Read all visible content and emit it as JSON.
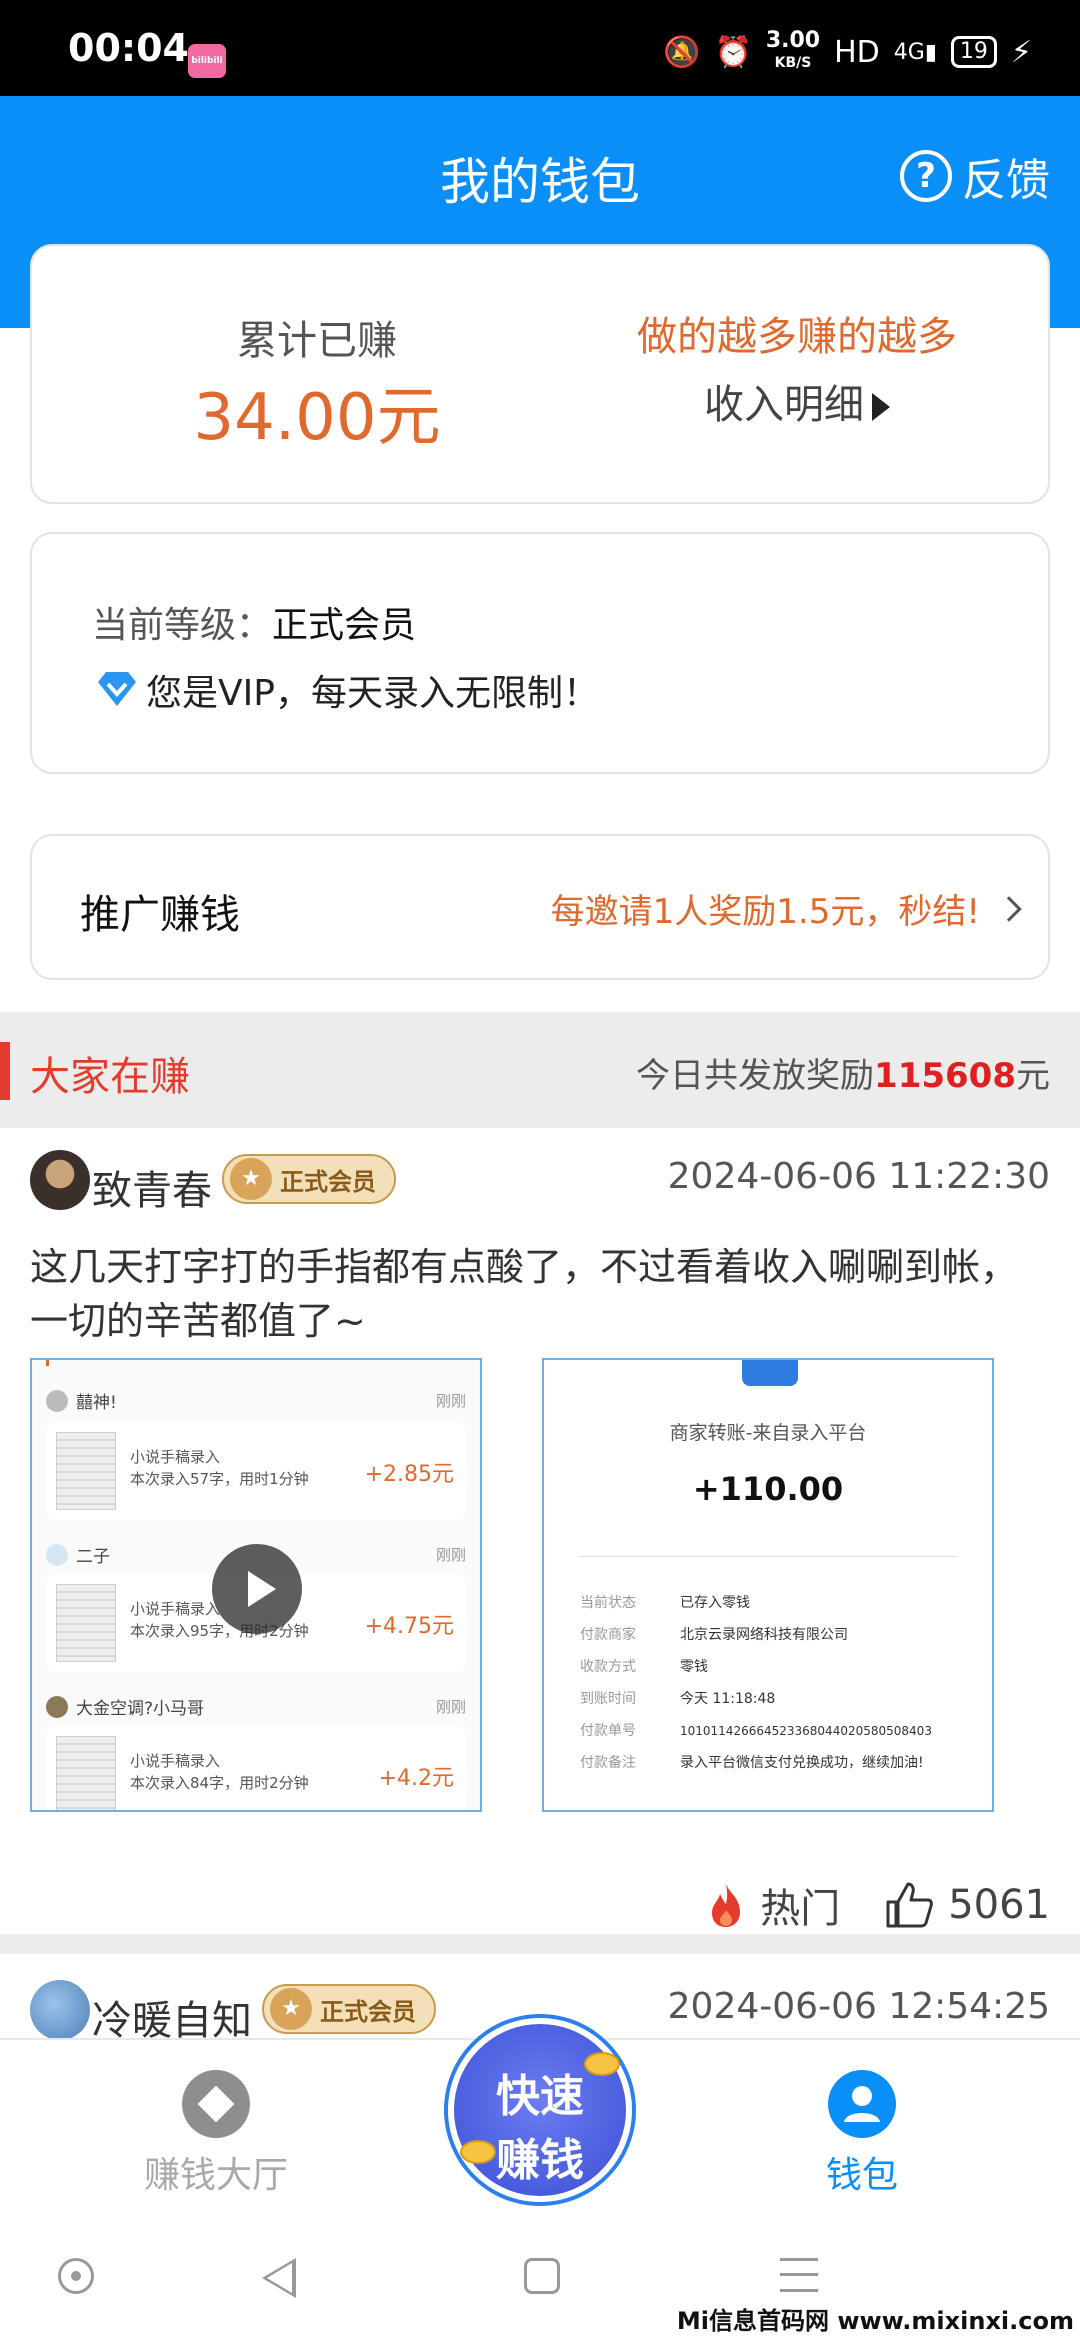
{
  "status_bar": {
    "time": "00:04",
    "app_icon_text": "bilibili",
    "speed": "3.00",
    "speed_unit": "KB/S",
    "hd": "HD",
    "network": "4G",
    "battery": "19"
  },
  "header": {
    "title": "我的钱包",
    "feedback": "反馈"
  },
  "earnings": {
    "label": "累计已赚",
    "amount": "34.00元",
    "slogan": "做的越多赚的越多",
    "detail_link": "收入明细"
  },
  "level": {
    "label": "当前等级：",
    "value": "正式会员",
    "vip_text": "您是VIP，每天录入无限制！"
  },
  "promotion": {
    "label": "推广赚钱",
    "reward": "每邀请1人奖励1.5元，秒结!"
  },
  "feed_section": {
    "title": "大家在赚",
    "total_prefix": "今日共发放奖励",
    "total_value": "115608",
    "total_suffix": "元"
  },
  "posts": [
    {
      "username": "致青春",
      "badge": "正式会员",
      "timestamp": "2024-06-06 11:22:30",
      "text": "这几天打字打的手指都有点酸了，不过看着收入唰唰到帐，一切的辛苦都值了~",
      "hot_label": "热门",
      "likes": "5061"
    },
    {
      "username": "冷暖自知",
      "badge": "正式会员",
      "timestamp": "2024-06-06 12:54:25"
    }
  ],
  "screenshot_left": {
    "entries": [
      {
        "name": "囍神!",
        "ago": "刚刚",
        "title": "小说手稿录入",
        "detail": "本次录入57字，用时1分钟",
        "amount": "+2.85元"
      },
      {
        "name": "二子",
        "ago": "刚刚",
        "title": "小说手稿录入",
        "detail": "本次录入95字，用时2分钟",
        "amount": "+4.75元"
      },
      {
        "name": "大金空调?小马哥",
        "ago": "刚刚",
        "title": "小说手稿录入",
        "detail": "本次录入84字，用时2分钟",
        "amount": "+4.2元"
      }
    ]
  },
  "screenshot_right": {
    "title": "商家转账-来自录入平台",
    "amount": "+110.00",
    "rows": [
      {
        "k": "当前状态",
        "v": "已存入零钱"
      },
      {
        "k": "付款商家",
        "v": "北京云录网络科技有限公司"
      },
      {
        "k": "收款方式",
        "v": "零钱"
      },
      {
        "k": "到账时间",
        "v": "今天 11:18:48"
      },
      {
        "k": "付款单号",
        "v": "1010114266645233680440205805084​03"
      },
      {
        "k": "付款备注",
        "v": "录入平台微信支付兑换成功，继续加油!"
      }
    ]
  },
  "tabbar": {
    "hall": "赚钱大厅",
    "fab_line1": "快速",
    "fab_line2": "赚钱",
    "wallet": "钱包"
  },
  "watermark": "Mi信息首码网 www.mixinxi.com",
  "colors": {
    "brand_blue": "#0a8ef8",
    "accent_orange": "#e0692d",
    "accent_red": "#e53b2c"
  }
}
